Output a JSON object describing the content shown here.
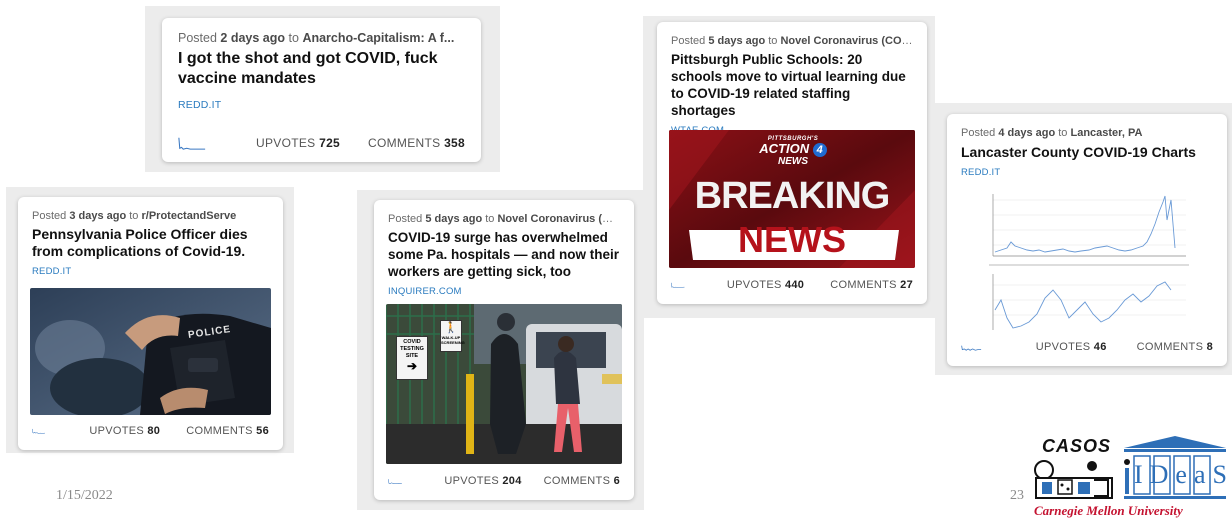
{
  "slide": {
    "date": "1/15/2022",
    "page_number": "23"
  },
  "labels": {
    "posted": "Posted",
    "to": "to",
    "upvotes": "UPVOTES",
    "comments": "COMMENTS"
  },
  "posts": [
    {
      "age": "2 days ago",
      "community": "Anarcho-Capitalism: A f...",
      "title": "I got the shot and got COVID, fuck vaccine mandates",
      "domain": "REDD.IT",
      "upvotes": "725",
      "comments": "358"
    },
    {
      "age": "3 days ago",
      "community": "r/ProtectandServe",
      "title": "Pennsylvania Police Officer dies from complications of Covid-19.",
      "domain": "REDD.IT",
      "upvotes": "80",
      "comments": "56"
    },
    {
      "age": "5 days ago",
      "community": "Novel Coronavirus (COV...",
      "title": "COVID-19 surge has overwhelmed some Pa. hospitals — and now their workers are getting sick, too",
      "domain": "INQUIRER.COM",
      "upvotes": "204",
      "comments": "6"
    },
    {
      "age": "5 days ago",
      "community": "Novel Coronavirus (COV...",
      "title": "Pittsburgh Public Schools: 20 schools move to virtual learning due to COVID-19 related staffing shortages",
      "domain": "WTAE.COM",
      "upvotes": "440",
      "comments": "27"
    },
    {
      "age": "4 days ago",
      "community": "Lancaster, PA",
      "title": "Lancaster County COVID-19 Charts",
      "domain": "REDD.IT",
      "upvotes": "46",
      "comments": "8"
    }
  ],
  "thumbnails": {
    "police": {
      "patch_text": "POLICE"
    },
    "testing": {
      "sign1_l1": "COVID",
      "sign1_l2": "TESTING",
      "sign1_l3": "SITE",
      "sign2_l1": "WALK-UP",
      "sign2_l2": "SCREENING"
    },
    "news": {
      "station_top": "PITTSBURGH'S",
      "station_mid": "ACTION",
      "station_bottom": "NEWS",
      "channel": "4",
      "line1": "BREAKING",
      "line2": "NEWS"
    }
  },
  "logos": {
    "casos": "CASOS",
    "ideas": "IDeaS",
    "university": "Carnegie Mellon University"
  },
  "colors": {
    "domain_link": "#2a7bbf",
    "sparkline": "#3a78c2",
    "cmu_red": "#c41230",
    "ideas_blue": "#2e6fb7",
    "news_red": "#b5121b"
  }
}
